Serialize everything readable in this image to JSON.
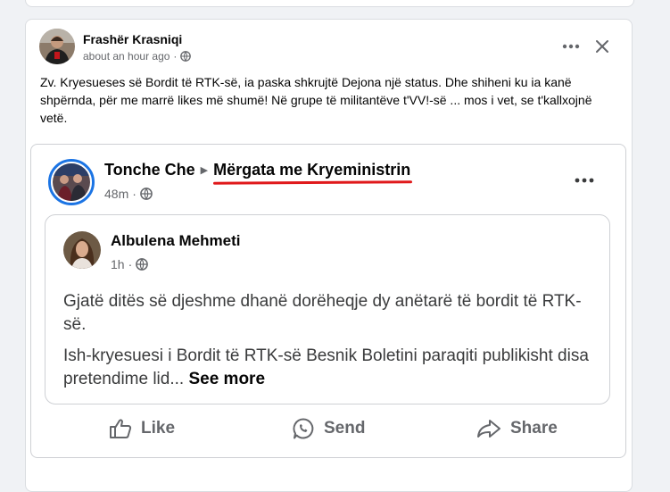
{
  "post": {
    "author": "Frashër Krasniqi",
    "time": "about an hour ago",
    "dot": "·",
    "text": "Zv. Kryesueses së Bordit të RTK-së, ia paska shkrujtë Dejona një status. Dhe shiheni ku ia kanë shpërnda, për me marrë likes më shumë! Në grupe të militantëve t'VV!-së ... mos i vet, se t'kallxojnë vetë."
  },
  "shared": {
    "author": "Tonche Che",
    "arrow": "▶",
    "group": "Mërgata me Kryeministrin",
    "time": "48m",
    "dot": "·"
  },
  "inner": {
    "author": "Albulena Mehmeti",
    "time": "1h",
    "dot": "·",
    "paragraph1": "Gjatë ditës së djeshme dhanë dorëheqje dy anëtarë të bordit të RTK-së.",
    "paragraph2": "Ish-kryesuesi i Bordit të RTK-së Besnik Boletini paraqiti publikisht disa pretendime lid...",
    "see_more": "See more"
  },
  "actions": {
    "like": "Like",
    "send": "Send",
    "share": "Share"
  },
  "colors": {
    "underline": "#e0191b",
    "story_ring": "#1b74e4"
  },
  "icons": [
    "globe-icon",
    "more-icon",
    "close-icon",
    "like-icon",
    "send-icon",
    "share-icon"
  ]
}
